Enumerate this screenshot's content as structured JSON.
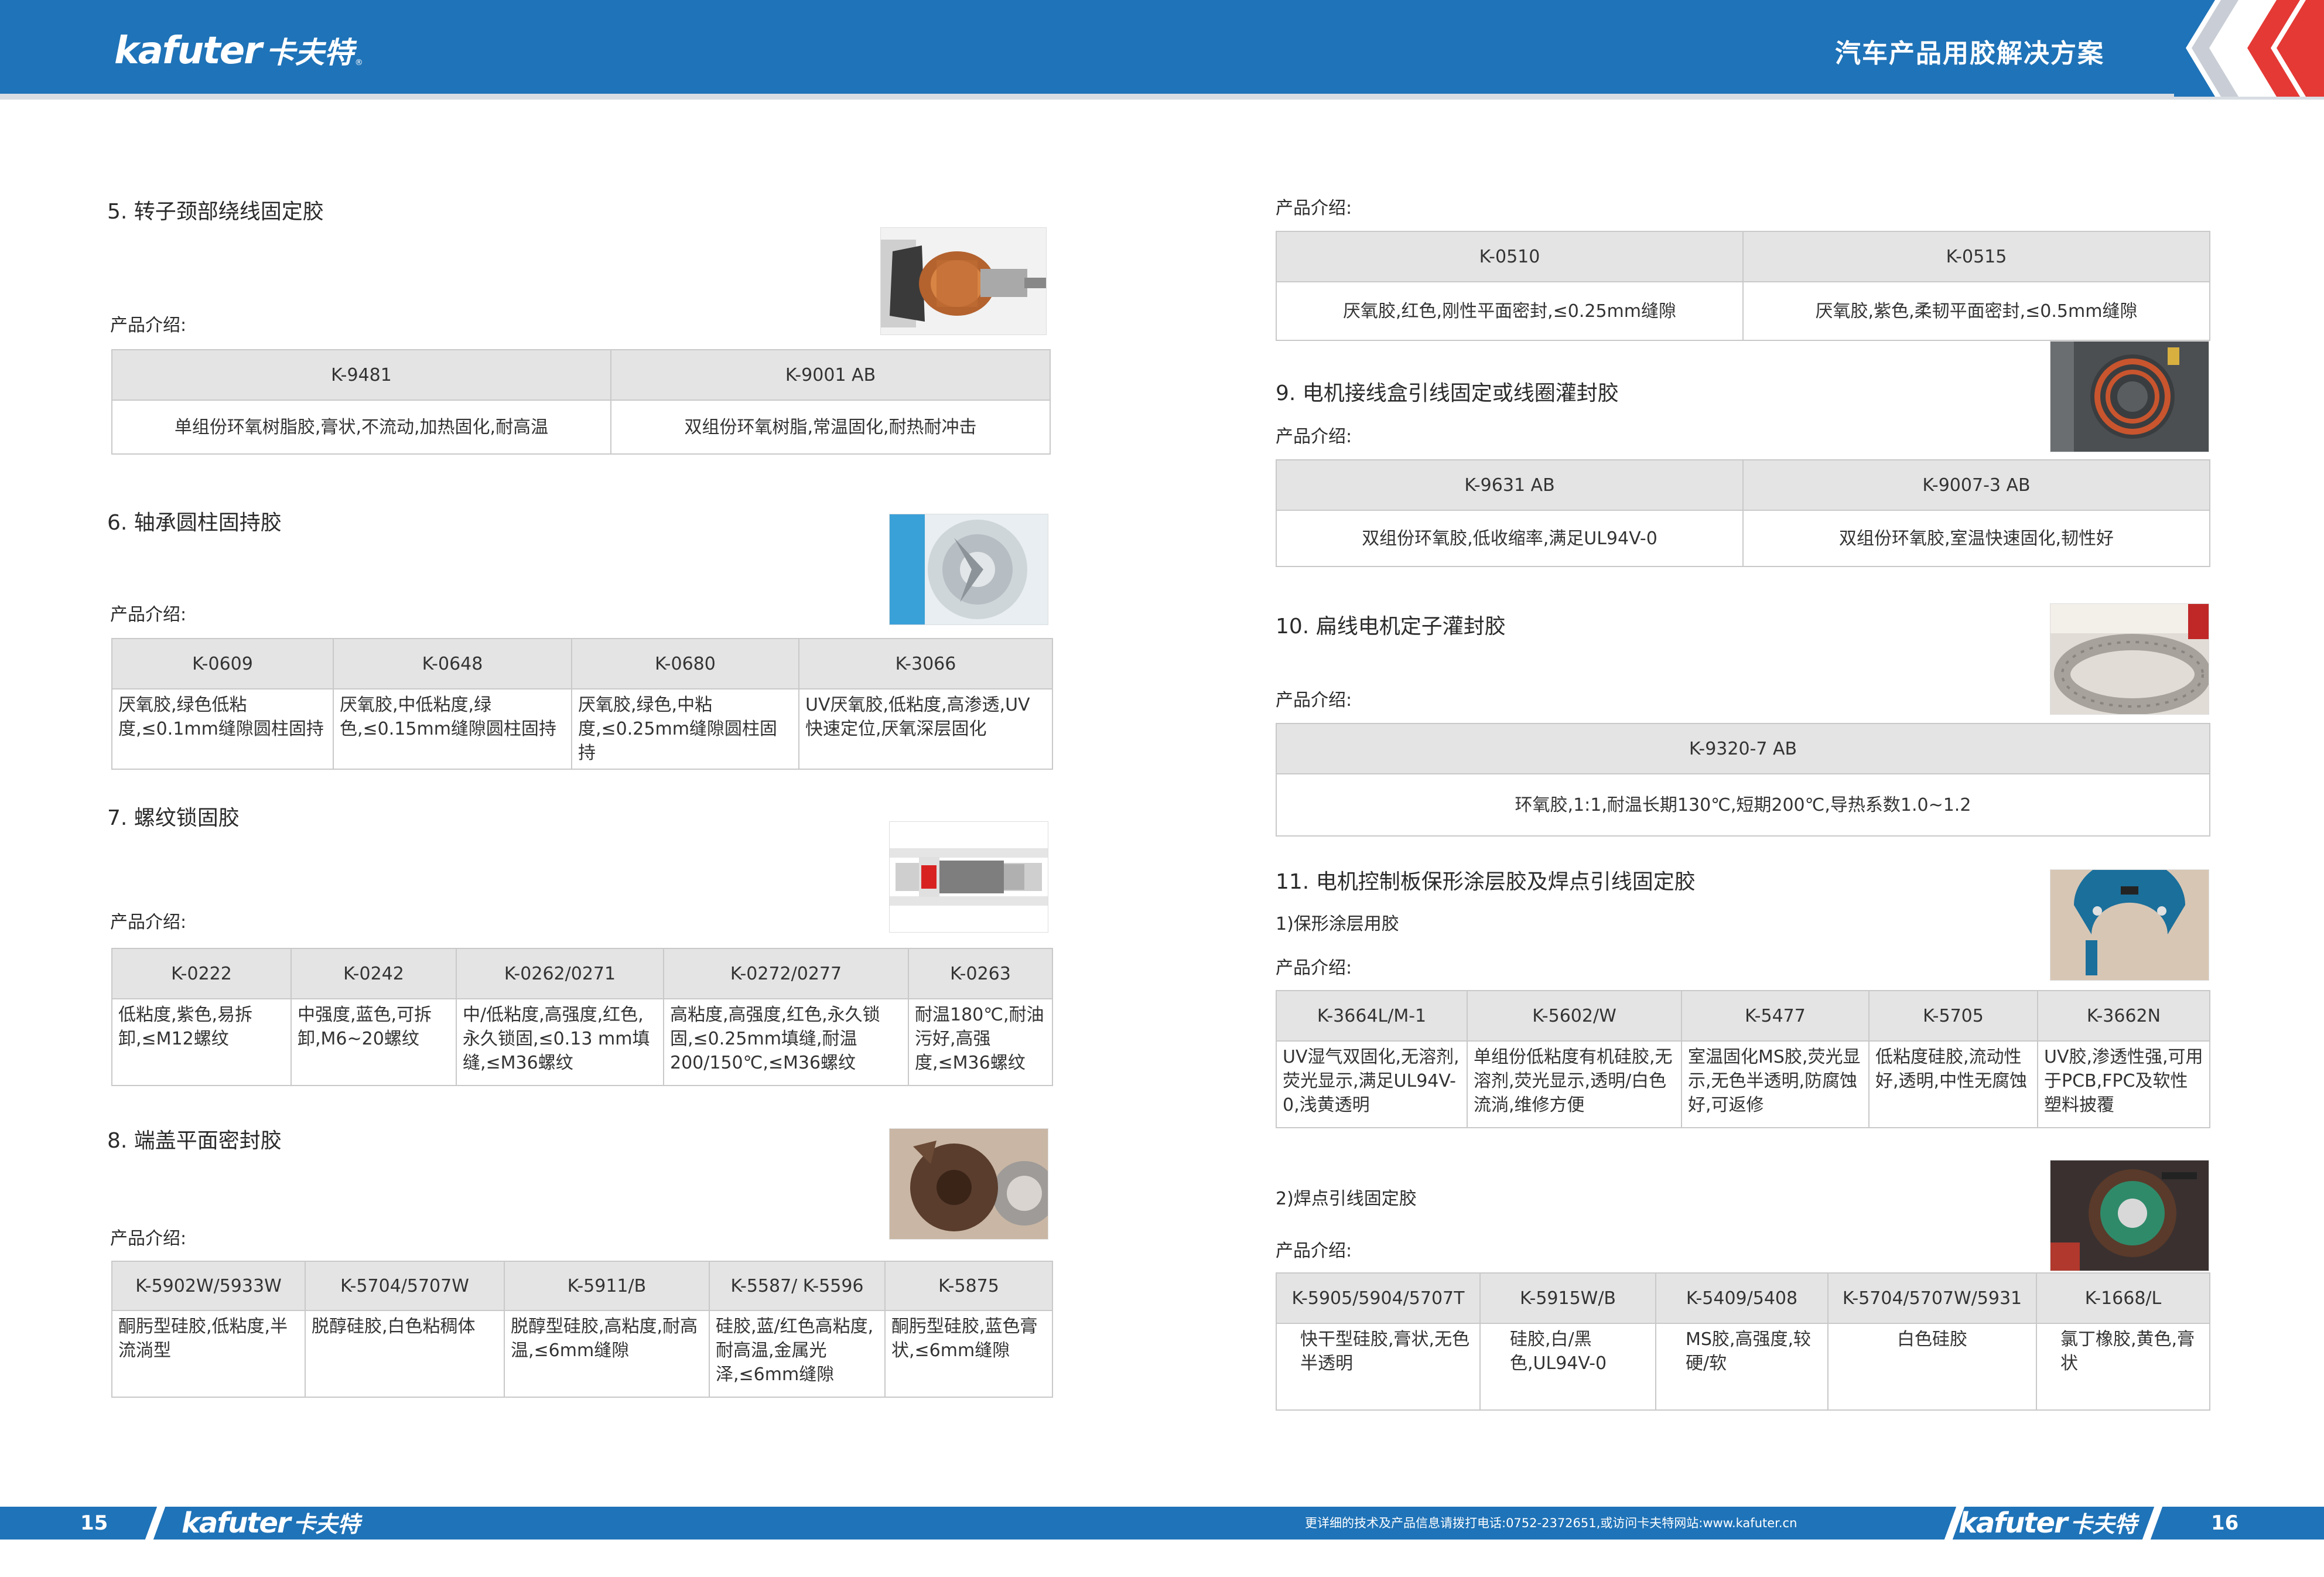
{
  "header": {
    "brand_en": "kafuter",
    "brand_cn": "卡夫特",
    "brand_reg": "®",
    "title": "汽车产品用胶解决方案",
    "color": "#1f73b8"
  },
  "intro_label": "产品介绍:",
  "left": {
    "s5": {
      "title": "5. 转子颈部绕线固定胶",
      "headers": [
        "K-9481",
        "K-9001 AB"
      ],
      "cells": [
        "单组份环氧树脂胶,膏状,不流动,加热固化,耐高温",
        "双组份环氧树脂,常温固化,耐热耐冲击"
      ]
    },
    "s6": {
      "title": "6. 轴承圆柱固持胶",
      "headers": [
        "K-0609",
        "K-0648",
        "K-0680",
        "K-3066"
      ],
      "cells": [
        "厌氧胶,绿色低粘度,≤0.1mm缝隙圆柱固持",
        "厌氧胶,中低粘度,绿色,≤0.15mm缝隙圆柱固持",
        "厌氧胶,绿色,中粘度,≤0.25mm缝隙圆柱固持",
        "UV厌氧胶,低粘度,高渗透,UV快速定位,厌氧深层固化"
      ]
    },
    "s7": {
      "title": "7. 螺纹锁固胶",
      "headers": [
        "K-0222",
        "K-0242",
        "K-0262/0271",
        "K-0272/0277",
        "K-0263"
      ],
      "cells": [
        "低粘度,紫色,易拆卸,≤M12螺纹",
        "中强度,蓝色,可拆卸,M6~20螺纹",
        "中/低粘度,高强度,红色,永久锁固,≤0.13 mm填缝,≤M36螺纹",
        "高粘度,高强度,红色,永久锁固,≤0.25mm填缝,耐温200/150℃,≤M36螺纹",
        "耐温180℃,耐油污好,高强度,≤M36螺纹"
      ]
    },
    "s8": {
      "title": "8. 端盖平面密封胶",
      "headers": [
        "K-5902W/5933W",
        "K-5704/5707W",
        "K-5911/B",
        "K-5587/ K-5596",
        "K-5875"
      ],
      "cells": [
        "酮肟型硅胶,低粘度,半流淌型",
        "脱醇硅胶,白色粘稠体",
        "脱醇型硅胶,高粘度,耐高温,≤6mm缝隙",
        "硅胶,蓝/红色高粘度,耐高温,金属光泽,≤6mm缝隙",
        "酮肟型硅胶,蓝色膏状,≤6mm缝隙"
      ]
    }
  },
  "right": {
    "s_top": {
      "headers": [
        "K-0510",
        "K-0515"
      ],
      "cells": [
        "厌氧胶,红色,刚性平面密封,≤0.25mm缝隙",
        "厌氧胶,紫色,柔韧平面密封,≤0.5mm缝隙"
      ]
    },
    "s9": {
      "title": "9. 电机接线盒引线固定或线圈灌封胶",
      "headers": [
        "K-9631 AB",
        "K-9007-3 AB"
      ],
      "cells": [
        "双组份环氧胶,低收缩率,满足UL94V-0",
        "双组份环氧胶,室温快速固化,韧性好"
      ]
    },
    "s10": {
      "title": "10. 扁线电机定子灌封胶",
      "headers": [
        "K-9320-7 AB"
      ],
      "cells": [
        "环氧胶,1:1,耐温长期130℃,短期200℃,导热系数1.0~1.2"
      ]
    },
    "s11": {
      "title": "11. 电机控制板保形涂层胶及焊点引线固定胶",
      "sub1": "1)保形涂层用胶",
      "headers1": [
        "K-3664L/M-1",
        "K-5602/W",
        "K-5477",
        "K-5705",
        "K-3662N"
      ],
      "cells1": [
        "UV湿气双固化,无溶剂,荧光显示,满足UL94V-0,浅黄透明",
        "单组份低粘度有机硅胶,无溶剂,荧光显示,透明/白色流淌,维修方便",
        "室温固化MS胶,荧光显示,无色半透明,防腐蚀好,可返修",
        "低粘度硅胶,流动性好,透明,中性无腐蚀",
        "UV胶,渗透性强,可用于PCB,FPC及软性塑料披覆"
      ],
      "sub2": "2)焊点引线固定胶",
      "headers2": [
        "K-5905/5904/5707T",
        "K-5915W/B",
        "K-5409/5408",
        "K-5704/5707W/5931",
        "K-1668/L"
      ],
      "cells2": [
        "快干型硅胶,膏状,无色半透明",
        "硅胶,白/黑色,UL94V-0",
        "MS胶,高强度,较硬/软",
        "白色硅胶",
        "氯丁橡胶,黄色,膏状"
      ]
    }
  },
  "footer": {
    "page_left": "15",
    "page_right": "16",
    "contact": "更详细的技术及产品信息请拨打电话:0752-2372651,或访问卡夫特网站:www.kafuter.cn",
    "brand_en": "kafuter",
    "brand_cn": "卡夫特"
  }
}
